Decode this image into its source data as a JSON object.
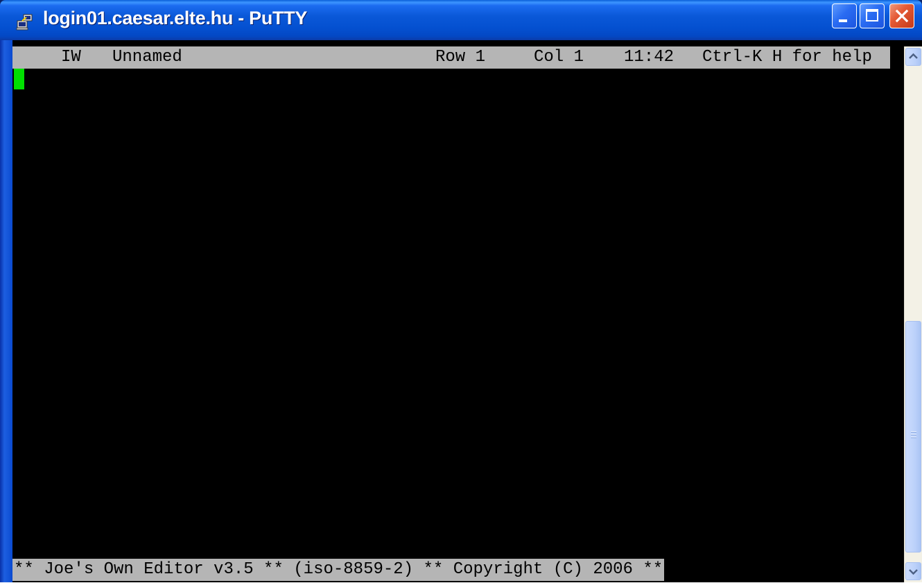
{
  "window": {
    "title": "login01.caesar.elte.hu - PuTTY",
    "icon": "putty-icon"
  },
  "controls": {
    "minimize_icon": "minimize-icon",
    "maximize_icon": "maximize-icon",
    "close_icon": "close-icon"
  },
  "editor": {
    "status": {
      "mode": "IW",
      "filename": "Unnamed",
      "row": "Row 1",
      "col": "Col 1",
      "time": "11:42",
      "help": "Ctrl-K H for help"
    },
    "message": "** Joe's Own Editor v3.5 ** (iso-8859-2) ** Copyright (C) 2006 **"
  },
  "colors": {
    "terminal_bg": "#000000",
    "statusbar_bg": "#b5b5b5",
    "cursor": "#00e000",
    "titlebar": "#0450d0"
  },
  "scrollbar": {
    "up_icon": "arrow-up-icon",
    "down_icon": "arrow-down-icon"
  }
}
